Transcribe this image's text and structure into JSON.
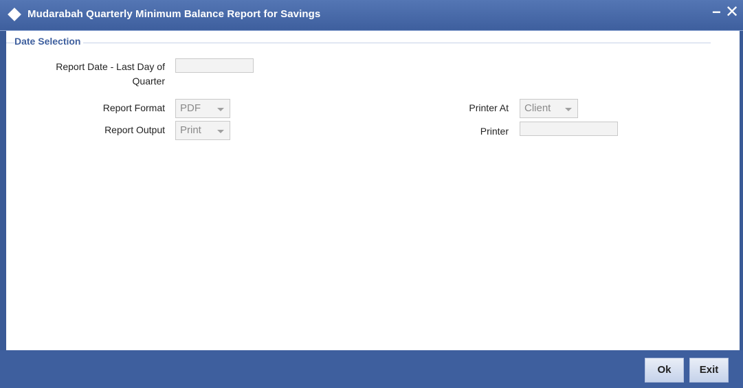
{
  "window": {
    "title": "Mudarabah Quarterly Minimum Balance Report for Savings",
    "minimize_label": "−",
    "close_label": "✕"
  },
  "section": {
    "legend": "Date Selection"
  },
  "fields": {
    "report_date_label_line1": "Report Date - Last Day of",
    "report_date_label_line2": "Quarter",
    "report_date_value": "",
    "report_format_label": "Report Format",
    "report_format_value": "PDF",
    "report_output_label": "Report Output",
    "report_output_value": "Print",
    "printer_at_label": "Printer At",
    "printer_at_value": "Client",
    "printer_label": "Printer",
    "printer_value": ""
  },
  "footer": {
    "ok_label": "Ok",
    "exit_label": "Exit"
  },
  "icons": {
    "title_icon": "diamond-icon",
    "dropdown_icon": "chevron-down-icon"
  },
  "colors": {
    "titlebar": "#4a6aaa",
    "accent": "#3e5f9e",
    "button": "#d6e0f1"
  }
}
